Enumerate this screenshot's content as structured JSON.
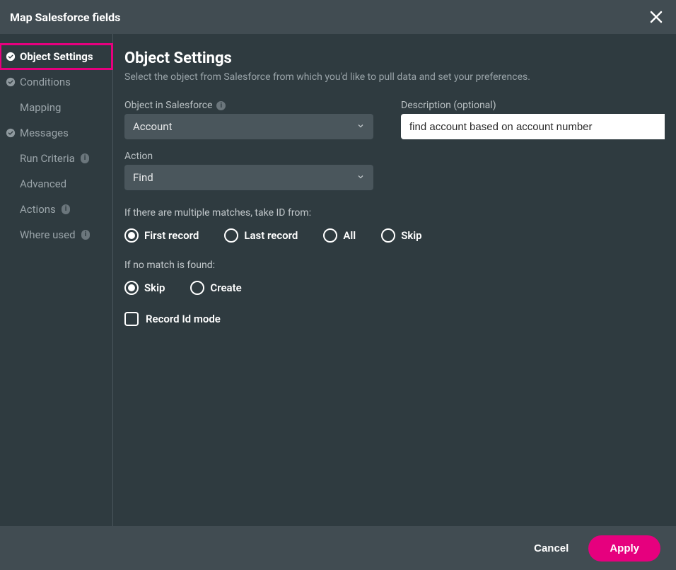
{
  "titlebar": {
    "title": "Map Salesforce fields"
  },
  "sidebar": {
    "items": [
      {
        "label": "Object Settings",
        "checked": true,
        "active": true,
        "highlighted": true,
        "badge": null
      },
      {
        "label": "Conditions",
        "checked": true,
        "active": false,
        "highlighted": false,
        "badge": null
      },
      {
        "label": "Mapping",
        "checked": false,
        "active": false,
        "highlighted": false,
        "badge": null
      },
      {
        "label": "Messages",
        "checked": true,
        "active": false,
        "highlighted": false,
        "badge": null
      },
      {
        "label": "Run Criteria",
        "checked": false,
        "active": false,
        "highlighted": false,
        "badge": "i"
      },
      {
        "label": "Advanced",
        "checked": false,
        "active": false,
        "highlighted": false,
        "badge": null
      },
      {
        "label": "Actions",
        "checked": false,
        "active": false,
        "highlighted": false,
        "badge": "i"
      },
      {
        "label": "Where used",
        "checked": false,
        "active": false,
        "highlighted": false,
        "badge": "i"
      }
    ]
  },
  "main": {
    "title": "Object Settings",
    "subtitle": "Select the object from Salesforce from which you'd like to pull data and set your preferences.",
    "object_label": "Object in Salesforce",
    "object_info": "i",
    "object_value": "Account",
    "description_label": "Description (optional)",
    "description_value": "find account based on account number",
    "action_label": "Action",
    "action_value": "Find",
    "multi_match_label": "If there are multiple matches, take ID from:",
    "multi_match_options": [
      {
        "label": "First record",
        "checked": true
      },
      {
        "label": "Last record",
        "checked": false
      },
      {
        "label": "All",
        "checked": false
      },
      {
        "label": "Skip",
        "checked": false
      }
    ],
    "no_match_label": "If no match is found:",
    "no_match_options": [
      {
        "label": "Skip",
        "checked": true
      },
      {
        "label": "Create",
        "checked": false
      }
    ],
    "record_id_mode_label": "Record Id mode",
    "record_id_mode_checked": false
  },
  "footer": {
    "cancel": "Cancel",
    "apply": "Apply"
  }
}
